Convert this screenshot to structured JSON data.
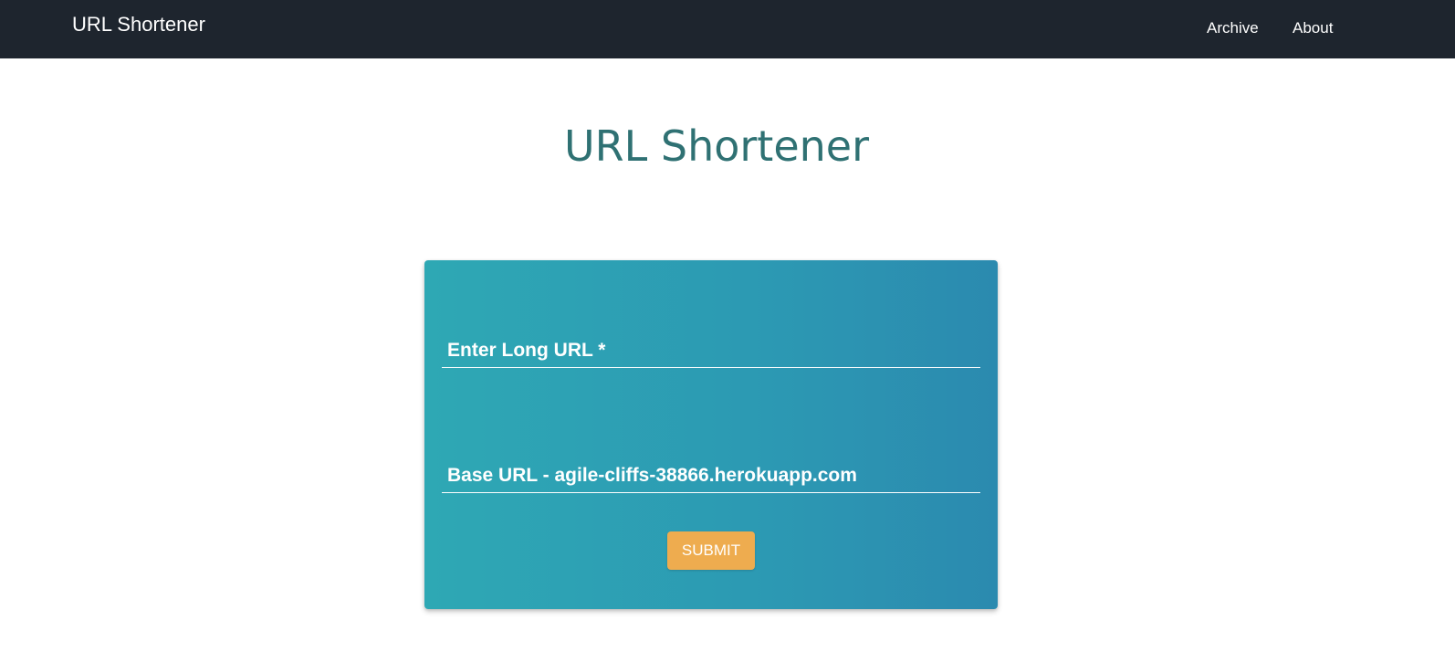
{
  "navbar": {
    "brand": "URL Shortener",
    "links": [
      {
        "label": "Archive"
      },
      {
        "label": "About"
      }
    ]
  },
  "main": {
    "title": "URL Shortener"
  },
  "form": {
    "long_url": {
      "placeholder": "Enter Long URL *",
      "value": ""
    },
    "base_url": {
      "placeholder": "Base URL - agile-cliffs-38866.herokuapp.com",
      "value": ""
    },
    "submit_label": "SUBMIT"
  },
  "colors": {
    "navbar_bg": "#1e252e",
    "title": "#2f7173",
    "card_gradient_start": "#2ea8b4",
    "card_gradient_end": "#2b8aaf",
    "submit_bg": "#eeac4f"
  }
}
